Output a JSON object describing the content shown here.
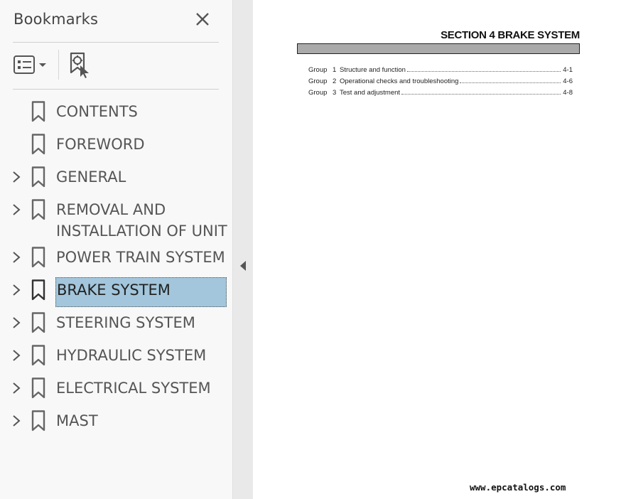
{
  "sidebar": {
    "title": "Bookmarks",
    "close_icon": "close-icon",
    "options_icon": "bookmark-options-icon",
    "add_bookmark_icon": "add-bookmark-icon",
    "items": [
      {
        "label": "CONTENTS",
        "expandable": false,
        "selected": false
      },
      {
        "label": "FOREWORD",
        "expandable": false,
        "selected": false
      },
      {
        "label": "GENERAL",
        "expandable": true,
        "selected": false
      },
      {
        "label": "REMOVAL AND",
        "label_line2": "INSTALLATION OF UNIT",
        "expandable": true,
        "selected": false
      },
      {
        "label": "POWER TRAIN SYSTEM",
        "expandable": true,
        "selected": false
      },
      {
        "label": "BRAKE SYSTEM",
        "expandable": true,
        "selected": true
      },
      {
        "label": "STEERING SYSTEM",
        "expandable": true,
        "selected": false
      },
      {
        "label": "HYDRAULIC SYSTEM",
        "expandable": true,
        "selected": false
      },
      {
        "label": "ELECTRICAL SYSTEM",
        "expandable": true,
        "selected": false
      },
      {
        "label": "MAST",
        "expandable": true,
        "selected": false
      }
    ],
    "selected_color": "#a3c6dc"
  },
  "document": {
    "section_title": "SECTION  4  BRAKE SYSTEM",
    "toc": [
      {
        "group": "Group",
        "num": "1",
        "title": "Structure and function",
        "page": "4-1"
      },
      {
        "group": "Group",
        "num": "2",
        "title": "Operational checks and troubleshooting",
        "page": "4-6"
      },
      {
        "group": "Group",
        "num": "3",
        "title": "Test and adjustment",
        "page": "4-8"
      }
    ],
    "watermark": "www.epcatalogs.com"
  }
}
